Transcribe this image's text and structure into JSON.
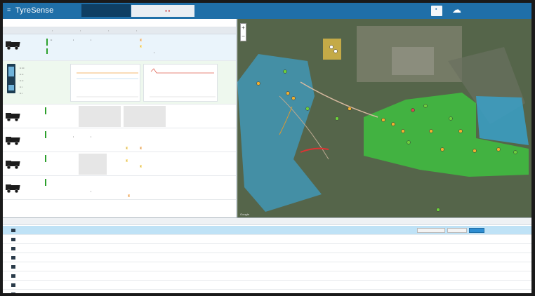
{
  "header": {
    "brand": "TyreSense",
    "brand_sub": "",
    "badge_text": "",
    "badge_dots": "● ●",
    "badge_labels": "",
    "square_button_icon": "info-icon",
    "cloud_icon": "cloud-icon",
    "user": ""
  },
  "left": {
    "toolbar_left": "",
    "toolbar_right": "",
    "section_title": "",
    "trucks": [
      {
        "id": ""
      },
      {
        "id": ""
      },
      {
        "id": ""
      },
      {
        "id": ""
      },
      {
        "id": ""
      },
      {
        "id": ""
      }
    ]
  },
  "map": {
    "google_mark": "Google"
  },
  "table": {
    "columns": [
      "",
      "",
      "",
      "",
      "",
      ""
    ],
    "rows": [
      {
        "c1": "",
        "c2": "",
        "c3": "",
        "c4": "",
        "c5": "",
        "selected": true
      },
      {
        "c1": "",
        "c2": "",
        "c3": "",
        "c4": "",
        "c5": "",
        "selected": false
      },
      {
        "c1": "",
        "c2": "",
        "c3": "",
        "c4": "",
        "c5": "",
        "selected": false
      },
      {
        "c1": "",
        "c2": "",
        "c3": "",
        "c4": "",
        "c5": "",
        "selected": false
      },
      {
        "c1": "",
        "c2": "",
        "c3": "",
        "c4": "",
        "c5": "",
        "selected": false
      },
      {
        "c1": "",
        "c2": "",
        "c3": "",
        "c4": "",
        "c5": "",
        "selected": false
      },
      {
        "c1": "",
        "c2": "",
        "c3": "",
        "c4": "",
        "c5": "",
        "selected": false
      },
      {
        "c1": "",
        "c2": "",
        "c3": "",
        "c4": "",
        "c5": "",
        "selected": false
      }
    ],
    "actions": {
      "b1": "",
      "b2": "",
      "b3": ""
    }
  },
  "colors": {
    "header": "#1f6fa8",
    "selected_row": "#bfe2f6",
    "zone_green": "#3fbf3f",
    "zone_blue": "#3aa0c8"
  }
}
